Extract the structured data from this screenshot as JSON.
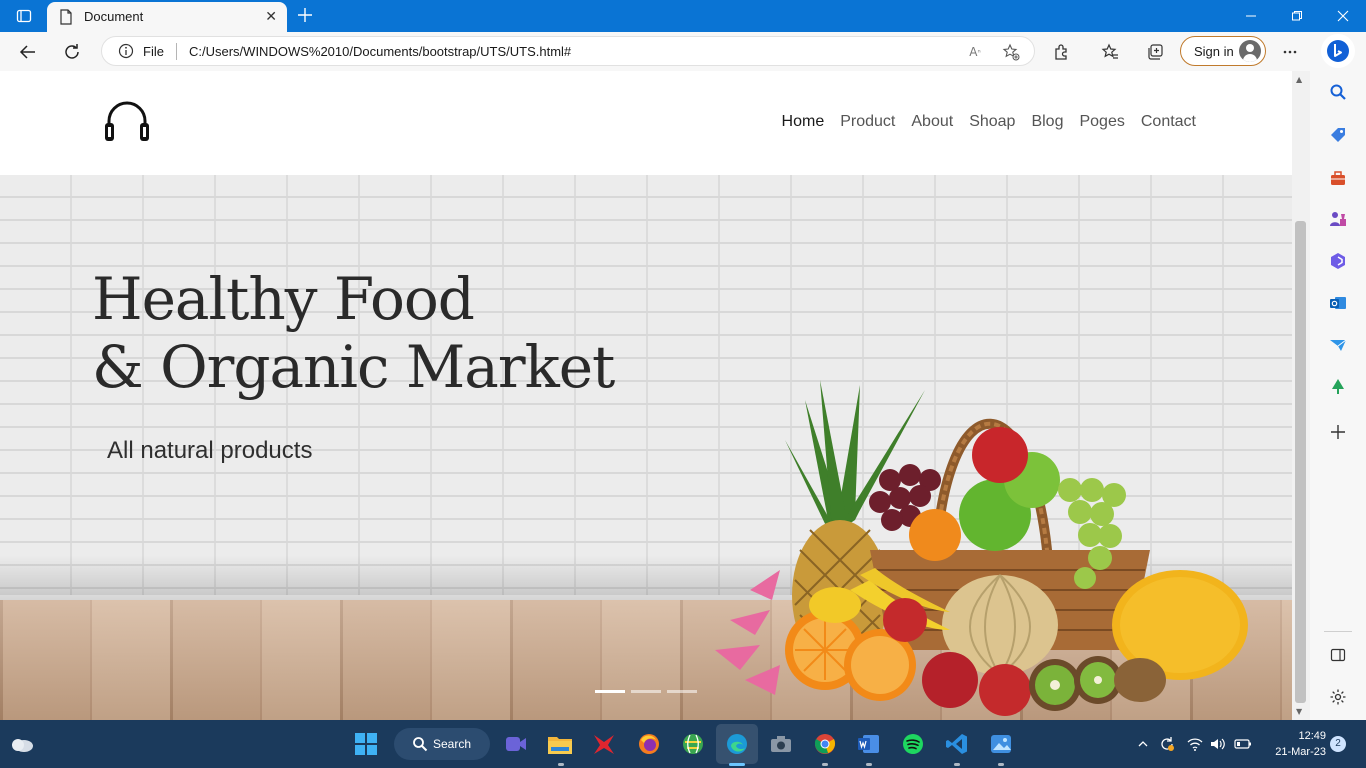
{
  "browser": {
    "tab_title": "Document",
    "address_scheme": "File",
    "address_url": "C:/Users/WINDOWS%2010/Documents/bootstrap/UTS/UTS.html#",
    "signin_label": "Sign in"
  },
  "site": {
    "nav_items": [
      "Home",
      "Product",
      "About",
      "Shoap",
      "Blog",
      "Poges",
      "Contact"
    ],
    "active_item": "Home",
    "hero_title_line1": "Healthy Food",
    "hero_title_line2": "& Organic Market",
    "hero_subtitle": "All natural products",
    "carousel": {
      "slide_count": 3,
      "active_index": 0
    }
  },
  "taskbar": {
    "search_label": "Search",
    "time": "12:49",
    "date": "21-Mar-23",
    "notification_count": "2"
  },
  "colors": {
    "titlebar": "#0a74d4",
    "taskbar": "#1b3a5c",
    "signin_border": "#c07a2c"
  }
}
